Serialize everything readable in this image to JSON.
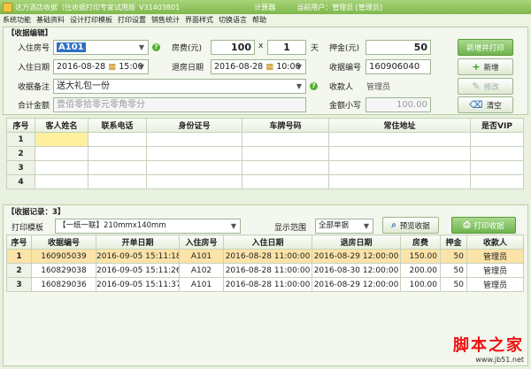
{
  "window": {
    "title": "达万酒店收据（住收据打印专家试用版",
    "version": "V31403801",
    "calc_label": "计算器",
    "current_user": "当前用户：管理员 [管理员]"
  },
  "menu": [
    "系统功能",
    "基础资料",
    "设计打印模板",
    "打印设置",
    "销售统计",
    "界面样式",
    "切换语言",
    "帮助"
  ],
  "edit": {
    "section_title": "【收据编辑】",
    "room_label": "入住房号",
    "room_value": "A101",
    "fee_label": "房费(元)",
    "fee_value": "100",
    "fee_mult": "x",
    "days_value": "1",
    "days_unit": "天",
    "deposit_label": "押金(元)",
    "deposit_value": "50",
    "checkin_label": "入住日期",
    "checkin_date": "2016-08-28",
    "checkin_time": "15:00",
    "checkout_label": "退房日期",
    "checkout_date": "2016-08-28",
    "checkout_time": "10:00",
    "receipt_no_label": "收据编号",
    "receipt_no_value": "160906040",
    "remark_label": "收据备注",
    "remark_value": "送大礼包一份",
    "payee_label": "收款人",
    "payee_value": "管理员",
    "total_label": "合计金额",
    "total_value": "壹佰零拾零元零角零分",
    "amount_label": "金额小写",
    "amount_value": "100.00",
    "buttons": {
      "save_print": "新增并打印",
      "new": "新增",
      "modify": "修改",
      "clear": "清空"
    }
  },
  "guests": {
    "headers": [
      "序号",
      "客人姓名",
      "联系电话",
      "身份证号",
      "车牌号码",
      "常住地址",
      "是否VIP"
    ],
    "rows": [
      "1",
      "2",
      "3",
      "4"
    ]
  },
  "records": {
    "section_title": "【收据记录：3】",
    "template_label": "打印模板",
    "template_value": "【一纸一联】210mmx140mm",
    "range_label": "显示范围",
    "range_value": "全部单据",
    "preview_button": "预览收据",
    "print_button": "打印收据",
    "headers": [
      "序号",
      "收据编号",
      "开单日期",
      "入住房号",
      "入住日期",
      "退房日期",
      "房费",
      "押金",
      "收款人"
    ],
    "rows": [
      [
        "1",
        "160905039",
        "2016-09-05 15:11:18",
        "A101",
        "2016-08-28 11:00:00",
        "2016-08-29 12:00:00",
        "150.00",
        "50",
        "管理员"
      ],
      [
        "2",
        "160829038",
        "2016-09-05 15:11:26",
        "A102",
        "2016-08-28 11:00:00",
        "2016-08-30 12:00:00",
        "200.00",
        "50",
        "管理员"
      ],
      [
        "3",
        "160829036",
        "2016-09-05 15:11:37",
        "A101",
        "2016-08-28 11:00:00",
        "2016-08-29 12:00:00",
        "100.00",
        "50",
        "管理员"
      ]
    ]
  },
  "watermark": {
    "brand": "脚本之家",
    "url": "www.jb51.net"
  },
  "colors": {
    "accent": "#7fb84c",
    "selected_row": "#fce3a8",
    "highlight": "#2f6fc2"
  }
}
